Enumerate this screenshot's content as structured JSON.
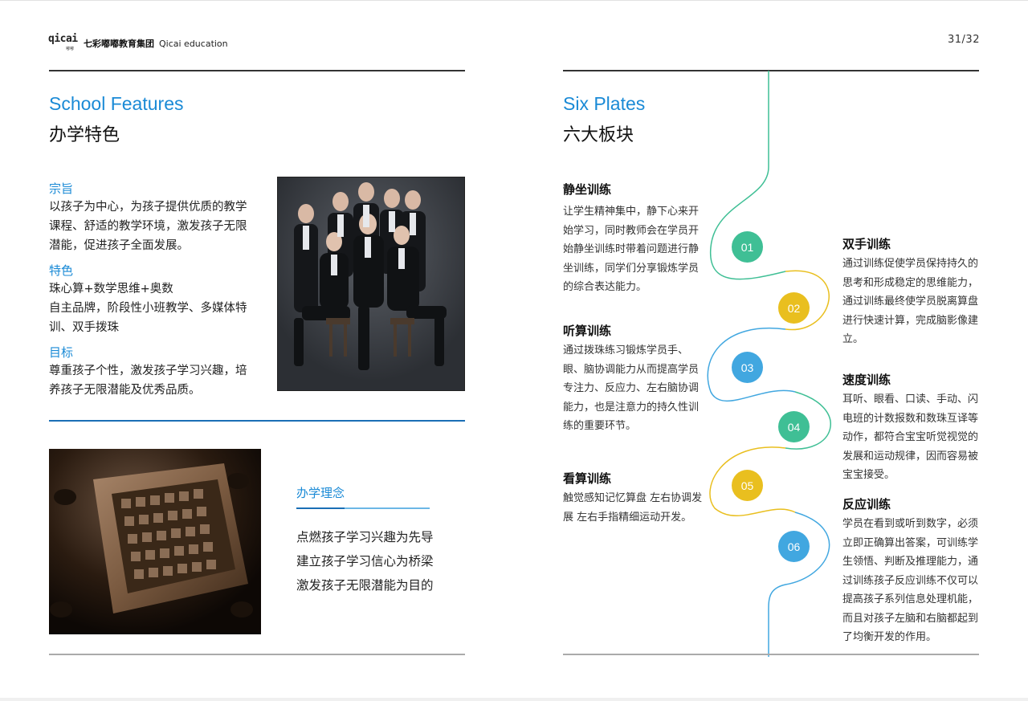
{
  "header": {
    "logo_mark": "qicai",
    "logo_mark_sub": "嘟嘟",
    "brand_cn": "七彩嘟嘟教育集团",
    "brand_en": "Qicai education",
    "page_number": "31/32"
  },
  "left": {
    "section_en": "School Features",
    "section_cn": "办学特色",
    "features": [
      {
        "title": "宗旨",
        "lines": [
          "以孩子为中心，为孩子提供优质的教学",
          "课程、舒适的教学环境，激发孩子无限",
          "潜能，促进孩子全面发展。"
        ]
      },
      {
        "title": "特色",
        "lines": [
          "珠心算+数学思维+奥数",
          "自主品牌，阶段性小班教学、多媒体特",
          "训、双手拨珠"
        ]
      },
      {
        "title": "目标",
        "lines": [
          "尊重孩子个性，激发孩子学习兴趣，培",
          "养孩子无限潜能及优秀品质。"
        ]
      }
    ],
    "philosophy_title": "办学理念",
    "philosophy_lines": [
      "点燃孩子学习兴趣为先导",
      "建立孩子学习信心为桥梁",
      "激发孩子无限潜能为目的"
    ]
  },
  "right": {
    "section_en": "Six Plates",
    "section_cn": "六大板块",
    "plates": [
      {
        "num": "01",
        "title": "静坐训练",
        "lines": [
          "让学生精神集中，静下心来开",
          "始学习，同时教师会在学员开",
          "始静坐训练时带着问题进行静",
          "坐训练，同学们分享锻炼学员",
          "的综合表达能力。"
        ]
      },
      {
        "num": "02",
        "title": "双手训练",
        "lines": [
          "通过训练促使学员保持持久的",
          "思考和形成稳定的思维能力，",
          "通过训练最终使学员脱离算盘",
          "进行快速计算，完成脑影像建",
          "立。"
        ]
      },
      {
        "num": "03",
        "title": "听算训练",
        "lines": [
          "通过拨珠练习锻炼学员手、",
          "眼、脑协调能力从而提高学员",
          "专注力、反应力、左右脑协调",
          "能力，也是注意力的持久性训",
          "练的重要环节。"
        ]
      },
      {
        "num": "04",
        "title": "速度训练",
        "lines": [
          "耳听、眼看、口读、手动、闪",
          "电班的计数报数和数珠互译等",
          "动作，都符合宝宝听觉视觉的",
          "发展和运动规律，因而容易被",
          "宝宝接受。"
        ]
      },
      {
        "num": "05",
        "title": "看算训练",
        "lines": [
          "触觉感知记忆算盘 左右协调发",
          "展 左右手指精细运动开发。"
        ]
      },
      {
        "num": "06",
        "title": "反应训练",
        "lines": [
          "学员在看到或听到数字，必须",
          "立即正确算出答案，可训练学",
          "生领悟、判断及推理能力，通",
          "过训练孩子反应训练不仅可以",
          "提高孩子系列信息处理机能，",
          "而且对孩子左脑和右脑都起到",
          "了均衡开发的作用。"
        ]
      }
    ]
  },
  "colors": {
    "accent_blue": "#1a8ad6",
    "green": "#3fbf95",
    "yellow": "#e9bf1f",
    "sky": "#41a7e0"
  }
}
